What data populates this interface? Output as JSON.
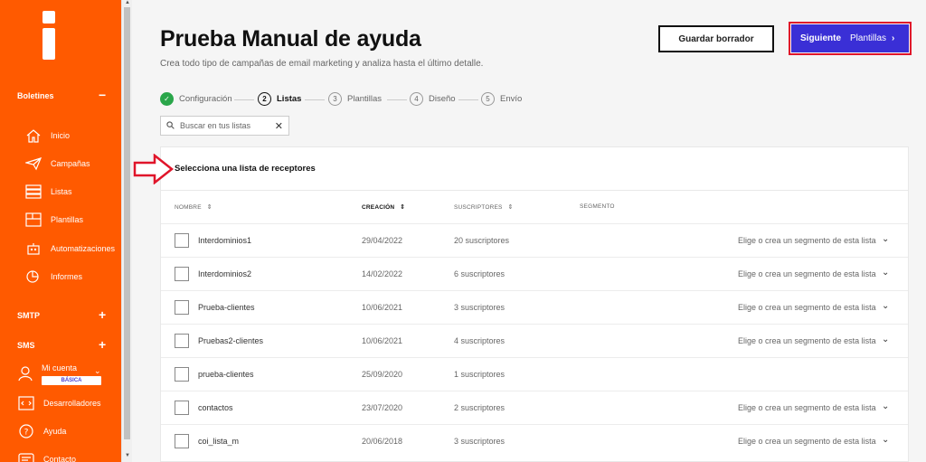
{
  "sidebar": {
    "sections": {
      "boletines": "Boletines",
      "smtp": "SMTP",
      "sms": "SMS"
    },
    "items": [
      {
        "label": "Inicio",
        "icon": "home-icon"
      },
      {
        "label": "Campañas",
        "icon": "paper-plane-icon"
      },
      {
        "label": "Listas",
        "icon": "list-icon"
      },
      {
        "label": "Plantillas",
        "icon": "template-icon"
      },
      {
        "label": "Automatizaciones",
        "icon": "robot-icon"
      },
      {
        "label": "Informes",
        "icon": "chart-icon"
      }
    ],
    "account": {
      "label": "Mi cuenta",
      "plan": "BÁSICA"
    },
    "bottom": [
      {
        "label": "Desarrolladores",
        "icon": "code-icon"
      },
      {
        "label": "Ayuda",
        "icon": "help-icon"
      },
      {
        "label": "Contacto",
        "icon": "chat-icon"
      }
    ],
    "accent": "#ff5a00"
  },
  "header": {
    "title": "Prueba Manual de ayuda",
    "subtitle": "Crea todo tipo de campañas de email marketing y analiza hasta el último detalle.",
    "draft_button": "Guardar borrador",
    "next_button": {
      "label": "Siguiente",
      "target": "Plantillas",
      "chevron": "›"
    },
    "primary_color": "#3a2fd6"
  },
  "steps": [
    {
      "num": "1",
      "label": "Configuración",
      "state": "done"
    },
    {
      "num": "2",
      "label": "Listas",
      "state": "active"
    },
    {
      "num": "3",
      "label": "Plantillas",
      "state": "pending"
    },
    {
      "num": "4",
      "label": "Diseño",
      "state": "pending"
    },
    {
      "num": "5",
      "label": "Envío",
      "state": "pending"
    }
  ],
  "search": {
    "placeholder": "Buscar en tus listas",
    "clear": "✕"
  },
  "card": {
    "title": "Selecciona una lista de receptores",
    "columns": {
      "name": "NOMBRE",
      "created": "CREACIÓN",
      "subscribers": "SUSCRIPTORES",
      "segment": "SEGMENTO"
    },
    "rows": [
      {
        "name": "Interdominios1",
        "date": "29/04/2022",
        "subs": "20 suscriptores",
        "segment": "Elige o crea un segmento de esta lista",
        "chevron": "⌄"
      },
      {
        "name": "Interdominios2",
        "date": "14/02/2022",
        "subs": "6 suscriptores",
        "segment": "Elige o crea un segmento de esta lista",
        "chevron": "⌄"
      },
      {
        "name": "Prueba-clientes",
        "date": "10/06/2021",
        "subs": "3 suscriptores",
        "segment": "Elige o crea un segmento de esta lista",
        "chevron": "⌄"
      },
      {
        "name": "Pruebas2-clientes",
        "date": "10/06/2021",
        "subs": "4 suscriptores",
        "segment": "Elige o crea un segmento de esta lista",
        "chevron": "⌄"
      },
      {
        "name": "prueba-clientes",
        "date": "25/09/2020",
        "subs": "1 suscriptores",
        "segment": "",
        "chevron": ""
      },
      {
        "name": "contactos",
        "date": "23/07/2020",
        "subs": "2 suscriptores",
        "segment": "Elige o crea un segmento de esta lista",
        "chevron": "⌄"
      },
      {
        "name": "coi_lista_m",
        "date": "20/06/2018",
        "subs": "3 suscriptores",
        "segment": "Elige o crea un segmento de esta lista",
        "chevron": "⌄"
      }
    ]
  },
  "annotation_color": "#e0152a"
}
